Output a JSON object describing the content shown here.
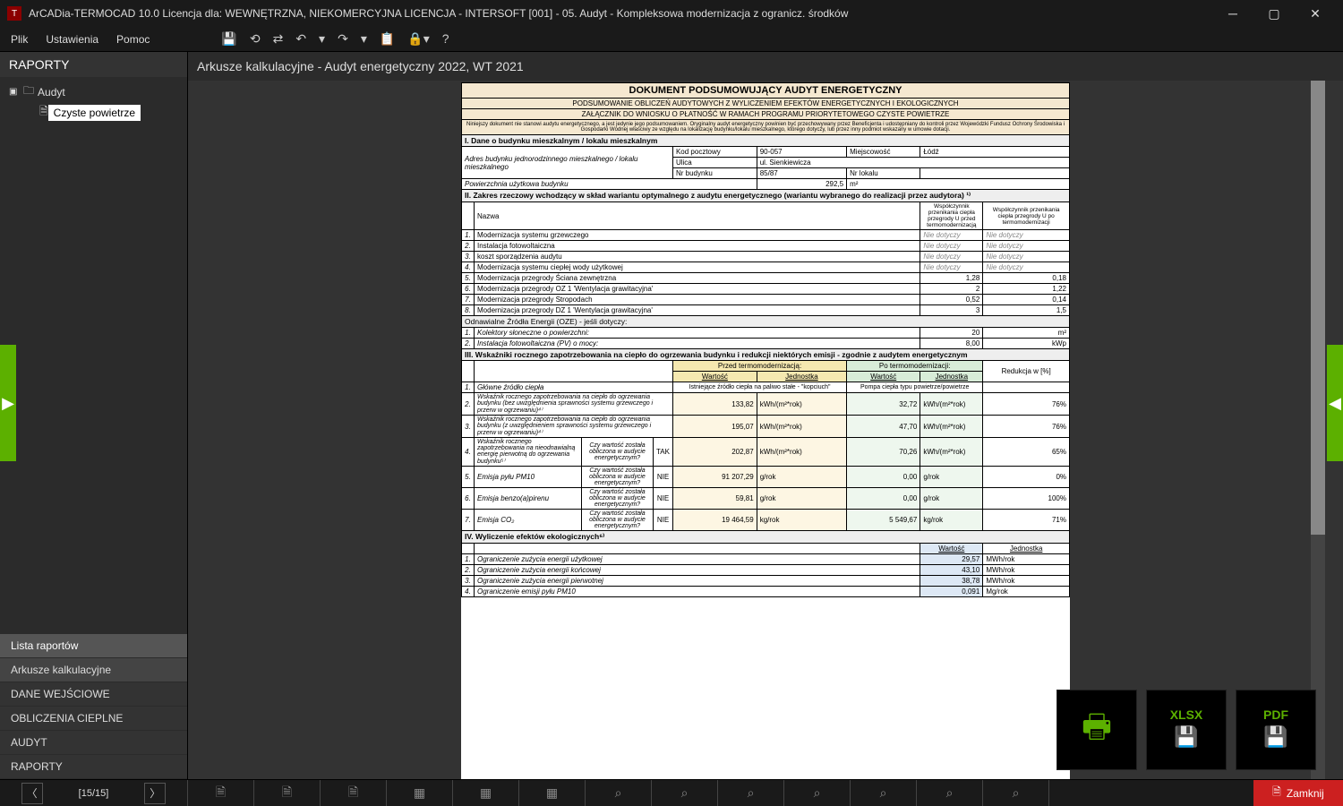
{
  "titlebar": {
    "title": "ArCADia-TERMOCAD 10.0 Licencja dla: WEWNĘTRZNA, NIEKOMERCYJNA LICENCJA - INTERSOFT [001] - 05. Audyt - Kompleksowa modernizacja z ogranicz. środków"
  },
  "menubar": {
    "file": "Plik",
    "settings": "Ustawienia",
    "help": "Pomoc"
  },
  "left": {
    "header": "RAPORTY",
    "treeRoot": "Audyt",
    "treeSelected": "Czyste powietrze",
    "nav": {
      "lista": "Lista raportów",
      "arkusze": "Arkusze kalkulacyjne",
      "dane": "DANE WEJŚCIOWE",
      "oblicz": "OBLICZENIA CIEPLNE",
      "audyt": "AUDYT",
      "raporty": "RAPORTY"
    }
  },
  "content": {
    "header": "Arkusze kalkulacyjne - Audyt energetyczny 2022, WT 2021"
  },
  "pager": {
    "label": "[15/15]"
  },
  "doc": {
    "title1": "DOKUMENT PODSUMOWUJĄCY AUDYT ENERGETYCZNY",
    "title2a": "PODSUMOWANIE OBLICZEŃ AUDYTOWYCH Z WYLICZENIEM EFEKTÓW ENERGETYCZNYCH I EKOLOGICZNYCH",
    "title2b": "ZAŁĄCZNIK DO WNIOSKU O PŁATNOŚĆ W RAMACH PROGRAMU PRIORYTETOWEGO CZYSTE POWIETRZE",
    "fineprint": "Niniejszy dokument nie stanowi audytu energetycznego, a jest jedynie jego podsumowaniem. Oryginalny audyt energetyczny powinien być przechowywany przez Beneficjenta i udostępniany do kontroli przez Wojewódzki Fundusz Ochrony Środowiska i Gospodarki Wodnej właściwy ze względu na lokalizację budynku/lokalu mieszkalnego, którego dotyczy, lub przez inny podmiot wskazany w umowie dotacji.",
    "sec1": "I. Dane o budynku mieszkalnym / lokalu mieszkalnym",
    "addrLabel": "Adres budynku jednorodzinnego mieszkalnego / lokalu mieszkalnego",
    "kod_l": "Kod pocztowy",
    "kod_v": "90-057",
    "miej_l": "Miejscowość",
    "miej_v": "Łódź",
    "ulica_l": "Ulica",
    "ulica_v": "ul. Sienkiewicza",
    "nrb_l": "Nr budynku",
    "nrb_v": "85/87",
    "nrl_l": "Nr lokalu",
    "nrl_v": "",
    "pow_l": "Powierzchnia użytkowa budynku",
    "pow_v": "292,5",
    "pow_u": "m²",
    "sec2": "II. Zakres rzeczowy wchodzący w skład wariantu optymalnego z audytu energetycznego (wariantu wybranego do realizacji przez audytora) ¹⁾",
    "s2_nazwa": "Nazwa",
    "s2_col1": "Współczynnik przenikania ciepła przegrody U przed termomodernizacją",
    "s2_col2": "Współczynnik przenikania ciepła przegrody U po termomodernizacji",
    "nd": "Nie dotyczy",
    "s2r1": "Modernizacja systemu grzewczego",
    "s2r2": "Instalacja fotowoltaiczna",
    "s2r3": "koszt sporządzenia audytu",
    "s2r4": "Modernizacja systemu ciepłej wody użytkowej",
    "s2r5": "Modernizacja przegrody Ściana zewnętrzna",
    "s2r5a": "1,28",
    "s2r5b": "0,18",
    "s2r6": "Modernizacja przegrody OZ 1 'Wentylacja grawitacyjna'",
    "s2r6a": "2",
    "s2r6b": "1,22",
    "s2r7": "Modernizacja przegrody Stropodach",
    "s2r7a": "0,52",
    "s2r7b": "0,14",
    "s2r8": "Modernizacja przegrody DZ 1 'Wentylacja grawitacyjna'",
    "s2r8a": "3",
    "s2r8b": "1,5",
    "oze": "Odnawialne Źródła Energii (OZE) - jeśli dotyczy:",
    "oze1": "Kolektory słoneczne o powierzchni:",
    "oze1v": "20",
    "oze1u": "m²",
    "oze2": "Instalacja fotowoltaiczna (PV) o mocy:",
    "oze2v": "8,00",
    "oze2u": "kWp",
    "sec3": "III. Wskaźniki rocznego zapotrzebowania na ciepło do ogrzewania budynku i redukcji niektórych emisji - zgodnie z audytem energetycznym",
    "pre": "Przed termomodernizacją:",
    "post": "Po termomodernizacji:",
    "wart": "Wartość",
    "jedn": "Jednostka",
    "reduk": "Redukcja w [%]",
    "s3r1l": "Główne źródło ciepła",
    "s3r1a": "Istniejące źródło ciepła na paliwo stałe - \"kopciuch\"",
    "s3r1b": "Pompa ciepła typu powietrze/powietrze",
    "s3r2l": "Wskaźnik rocznego zapotrzebowania na ciepło do ogrzewania budynku (bez uwzględnienia sprawności systemu grzewczego i przerw w ogrzewaniu)⁴⁾",
    "s3r2a": "133,82",
    "s3r2b": "32,72",
    "s3r2u": "kWh/(m²*rok)",
    "s3r2r": "76%",
    "s3r3l": "Wskaźnik rocznego zapotrzebowania na ciepło do ogrzewania budynku (z uwzględnieniem sprawności systemu grzewczego i przerw w ogrzewaniu)⁴⁾",
    "s3r3a": "195,07",
    "s3r3b": "47,70",
    "s3r3r": "76%",
    "s3r4l": "Wskaźnik rocznego zapotrzebowania na nieodnawialną energię pierwotną do ogrzewania budynku⁵⁾",
    "s3q": "Czy wartość została obliczona w audycie energetycznym?",
    "tak": "TAK",
    "nie": "NIE",
    "s3r4a": "202,87",
    "s3r4b": "70,26",
    "s3r4r": "65%",
    "s3r5l": "Emisja pyłu PM10",
    "s3r5a": "91 207,29",
    "s3r5b": "0,00",
    "s3r5u": "g/rok",
    "s3r5r": "0%",
    "s3r6l": "Emisja benzo(a)pirenu",
    "s3r6a": "59,81",
    "s3r6b": "0,00",
    "s3r6r": "100%",
    "s3r7l": "Emisja CO₂",
    "s3r7a": "19 464,59",
    "s3r7b": "5 549,67",
    "s3r7u": "kg/rok",
    "s3r7r": "71%",
    "sec4": "IV. Wyliczenie efektów ekologicznych⁶⁾",
    "s4r1": "Ograniczenie zużycia energii użytkowej",
    "s4r1v": "29,57",
    "s4r1u": "MWh/rok",
    "s4r2": "Ograniczenie zużycia energii końcowej",
    "s4r2v": "43,10",
    "s4r2u": "MWh/rok",
    "s4r3": "Ograniczenie zużycia energii pierwotnej",
    "s4r3v": "38,78",
    "s4r3u": "MWh/rok",
    "s4r4": "Ograniczenie emisji pyłu PM10",
    "s4r4v": "0,091",
    "s4r4u": "Mg/rok"
  },
  "float": {
    "xlsx": "XLSX",
    "pdf": "PDF"
  },
  "close": "Zamknij"
}
